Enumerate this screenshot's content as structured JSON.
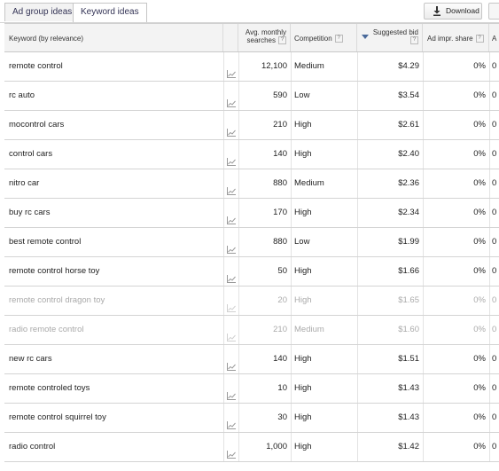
{
  "tabs": [
    {
      "label": "Ad group ideas",
      "active": false
    },
    {
      "label": "Keyword ideas",
      "active": true
    }
  ],
  "toolbar": {
    "download_label": "Download"
  },
  "columns": {
    "keyword": "Keyword (by relevance)",
    "avg_line1": "Avg. monthly",
    "avg_line2": "searches",
    "competition": "Competition",
    "bid_line1": "Suggested bid",
    "share": "Ad impr. share",
    "next_col": "A"
  },
  "help_glyph": "?",
  "rows": [
    {
      "keyword": "remote control",
      "searches": "12,100",
      "competition": "Medium",
      "bid": "$4.29",
      "share": "0%",
      "next": "0",
      "dim": false
    },
    {
      "keyword": "rc auto",
      "searches": "590",
      "competition": "Low",
      "bid": "$3.54",
      "share": "0%",
      "next": "0",
      "dim": false
    },
    {
      "keyword": "mocontrol cars",
      "searches": "210",
      "competition": "High",
      "bid": "$2.61",
      "share": "0%",
      "next": "0",
      "dim": false
    },
    {
      "keyword": "control cars",
      "searches": "140",
      "competition": "High",
      "bid": "$2.40",
      "share": "0%",
      "next": "0",
      "dim": false
    },
    {
      "keyword": "nitro car",
      "searches": "880",
      "competition": "Medium",
      "bid": "$2.36",
      "share": "0%",
      "next": "0",
      "dim": false
    },
    {
      "keyword": "buy rc cars",
      "searches": "170",
      "competition": "High",
      "bid": "$2.34",
      "share": "0%",
      "next": "0",
      "dim": false
    },
    {
      "keyword": "best remote control",
      "searches": "880",
      "competition": "Low",
      "bid": "$1.99",
      "share": "0%",
      "next": "0",
      "dim": false
    },
    {
      "keyword": "remote control horse toy",
      "searches": "50",
      "competition": "High",
      "bid": "$1.66",
      "share": "0%",
      "next": "0",
      "dim": false
    },
    {
      "keyword": "remote control dragon toy",
      "searches": "20",
      "competition": "High",
      "bid": "$1.65",
      "share": "0%",
      "next": "0",
      "dim": true
    },
    {
      "keyword": "radio remote control",
      "searches": "210",
      "competition": "Medium",
      "bid": "$1.60",
      "share": "0%",
      "next": "0",
      "dim": true
    },
    {
      "keyword": "new rc cars",
      "searches": "140",
      "competition": "High",
      "bid": "$1.51",
      "share": "0%",
      "next": "0",
      "dim": false
    },
    {
      "keyword": "remote controled toys",
      "searches": "10",
      "competition": "High",
      "bid": "$1.43",
      "share": "0%",
      "next": "0",
      "dim": false
    },
    {
      "keyword": "remote control squirrel toy",
      "searches": "30",
      "competition": "High",
      "bid": "$1.43",
      "share": "0%",
      "next": "0",
      "dim": false
    },
    {
      "keyword": "radio control",
      "searches": "1,000",
      "competition": "High",
      "bid": "$1.42",
      "share": "0%",
      "next": "0",
      "dim": false
    }
  ],
  "icons": {
    "trend": "trend-chart-icon",
    "download": "download-icon",
    "sort": "sort-descending-icon"
  },
  "colors": {
    "header_bg": "#f3f3f3",
    "grid_line": "#d4d4d4",
    "sort_arrow": "#4a6a9a",
    "dim_text": "#aaaaaa"
  }
}
